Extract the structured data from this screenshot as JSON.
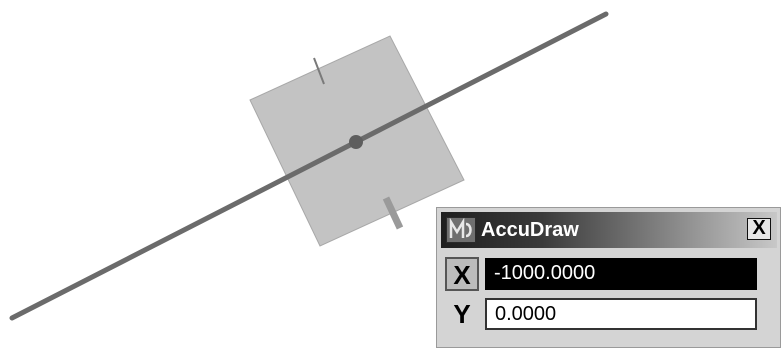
{
  "dialog": {
    "title": "AccuDraw",
    "close_label": "X",
    "x_axis_label": "X",
    "y_axis_label": "Y",
    "x_value": "-1000.0000",
    "y_value": "0.0000",
    "active_field": "X"
  },
  "viewport": {
    "icons": [
      "accudraw-compass",
      "drawing-line"
    ]
  },
  "colors": {
    "compass_fill": "#c0c0c0",
    "line": "#6e6e6e",
    "x_field_bg": "#000000",
    "titlebar_start": "#1e1e1e",
    "titlebar_end": "#c8c8c8"
  }
}
